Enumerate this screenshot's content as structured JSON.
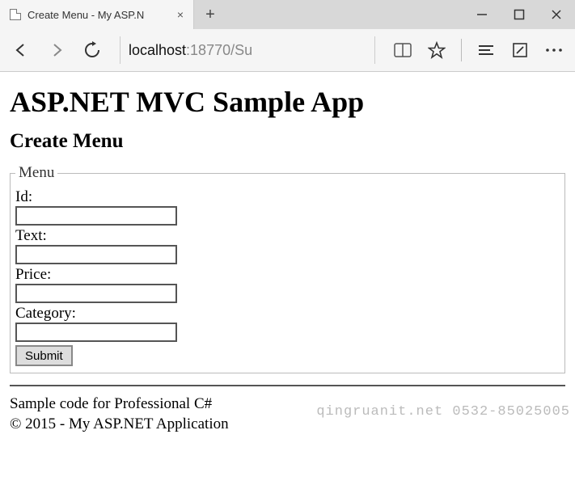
{
  "browser": {
    "tab_title": "Create Menu - My ASP.N",
    "address_host": "localhost",
    "address_rest": ":18770/Su"
  },
  "page": {
    "heading": "ASP.NET MVC Sample App",
    "subheading": "Create Menu",
    "fieldset_legend": "Menu",
    "fields": {
      "id_label": "Id:",
      "text_label": "Text:",
      "price_label": "Price:",
      "category_label": "Category:"
    },
    "submit_label": "Submit",
    "footer_line1": "Sample code for Professional C#",
    "footer_line2": "© 2015 - My ASP.NET Application"
  },
  "watermark": "qingruanit.net 0532-85025005"
}
